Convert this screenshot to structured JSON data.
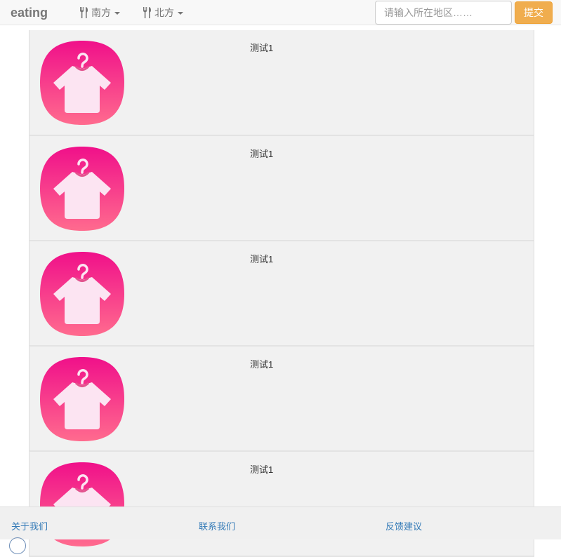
{
  "navbar": {
    "brand": "eating",
    "menus": [
      {
        "label": "南方",
        "icon": "cutlery-icon"
      },
      {
        "label": "北方",
        "icon": "cutlery-icon"
      }
    ],
    "search": {
      "placeholder": "请输入所在地区……",
      "value": ""
    },
    "submit_label": "提交"
  },
  "colors": {
    "submit_bg": "#f0ad4e",
    "icon_gradient_top": "#f0108a",
    "icon_gradient_bottom": "#ff6b8e",
    "link": "#337ab7"
  },
  "list": {
    "items": [
      {
        "title": "测试1",
        "image": "tshirt-icon"
      },
      {
        "title": "测试1",
        "image": "tshirt-icon"
      },
      {
        "title": "测试1",
        "image": "tshirt-icon"
      },
      {
        "title": "测试1",
        "image": "tshirt-icon"
      },
      {
        "title": "测试1",
        "image": "tshirt-icon"
      }
    ]
  },
  "footer": {
    "links": [
      {
        "label": "关于我们"
      },
      {
        "label": "联系我们"
      },
      {
        "label": "反馈建议"
      }
    ]
  }
}
